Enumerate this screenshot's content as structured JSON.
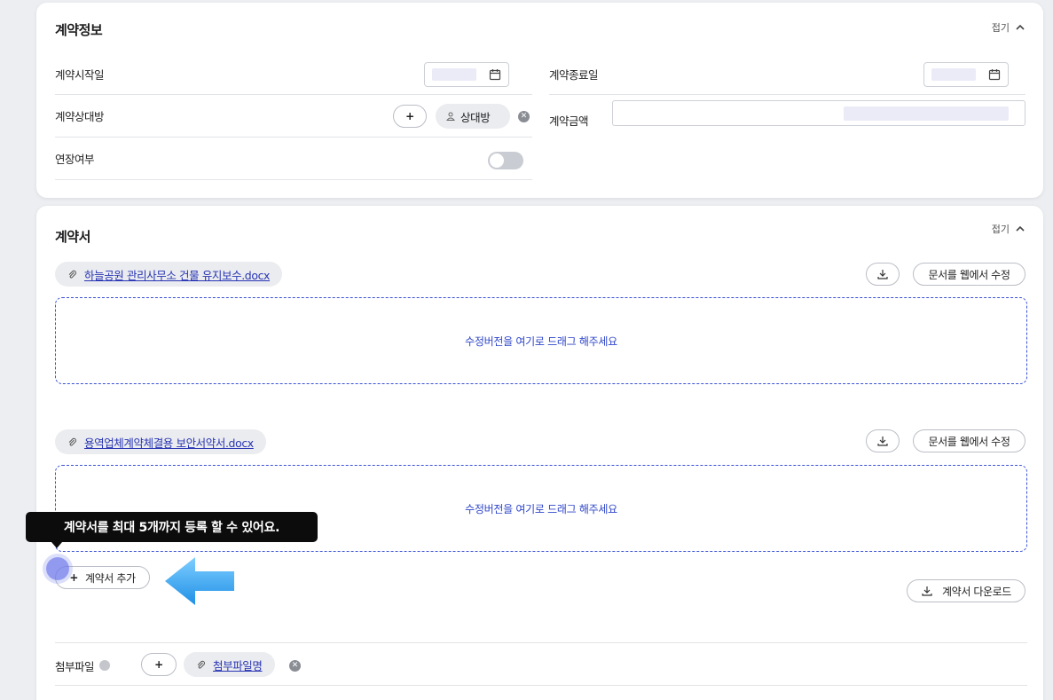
{
  "contract_info": {
    "title": "계약정보",
    "fold_label": "접기",
    "start_date_label": "계약시작일",
    "end_date_label": "계약종료일",
    "counterparty_label": "계약상대방",
    "counterparty_chip": "상대방",
    "add_symbol": "+",
    "amount_label": "계약금액",
    "extension_label": "연장여부"
  },
  "contract_docs": {
    "title": "계약서",
    "fold_label": "접기",
    "files": [
      {
        "name": "하늘공원 관리사무소 건물 유지보수.docx"
      },
      {
        "name": "용역업체계약체결용 보안서약서.docx"
      }
    ],
    "edit_web_label": "문서를 웹에서 수정",
    "drop_hint": "수정버전을 여기로 드래그 해주세요",
    "tooltip": "계약서를 최대 5개까지 등록 할 수 있어요.",
    "add_contract_label": "계약서 추가",
    "download_contracts_label": "계약서 다운로드",
    "attachment_label": "첨부파일",
    "attachment_chip": "첨부파일명"
  },
  "colors": {
    "accent": "#2f46c9",
    "arrow": "#38a8f0",
    "tooltip_bg": "#0c0c0c"
  },
  "icons": [
    "calendar-icon",
    "chevron-up-icon",
    "person-icon",
    "close-icon",
    "paperclip-icon",
    "download-icon",
    "plus-icon",
    "info-icon",
    "arrow-pointer-icon"
  ]
}
